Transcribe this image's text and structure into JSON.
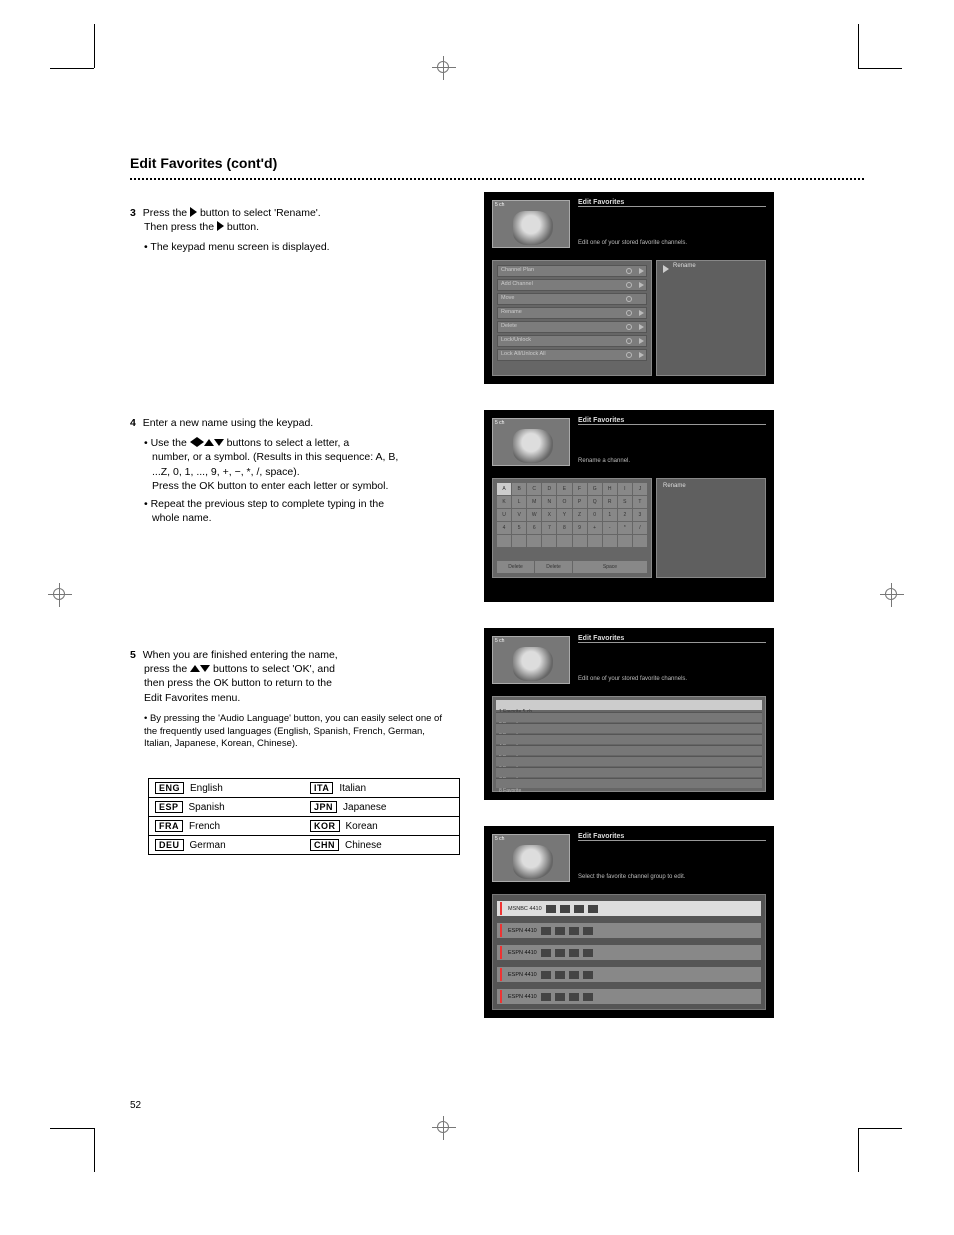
{
  "section_title": "Edit Favorites (cont'd)",
  "blocks": {
    "b1": {
      "num": "3",
      "line1_a": "Press the ",
      "line1_b": " button to select 'Rename'.",
      "line2_a": "Then press the ",
      "line2_b": " button.",
      "bullet": "The keypad menu screen is displayed."
    },
    "b2": {
      "num": "4",
      "line1": "Enter a new name using the keypad.",
      "arrows_a": "Use the ",
      "arrows_b": " buttons to select a letter, a",
      "l2": "number, or a symbol. (Results in this sequence: A, B,",
      "l3": "...Z, 0, 1, ..., 9, +, −, *, /, space).",
      "l4": "Press the OK button to enter each letter or symbol.",
      "l5": "Repeat the previous step to complete typing in the",
      "l6": "whole name."
    },
    "b3": {
      "num": "5",
      "line1": "When you are finished entering the name,",
      "arrows_a": "press the ",
      "arrows_b": " buttons to select 'OK', and",
      "l3": "then press the OK button to return to the",
      "l4": "Edit Favorites menu.",
      "sub": "By pressing the 'Audio Language' button, you can easily select one of the frequently used languages (English, Spanish, French, German, Italian, Japanese, Korean, Chinese)."
    }
  },
  "lang_table": [
    [
      {
        "chip": "ENG",
        "name": "English"
      },
      {
        "chip": "ITA",
        "name": "Italian"
      }
    ],
    [
      {
        "chip": "ESP",
        "name": "Spanish"
      },
      {
        "chip": "JPN",
        "name": "Japanese"
      }
    ],
    [
      {
        "chip": "FRA",
        "name": "French"
      },
      {
        "chip": "KOR",
        "name": "Korean"
      }
    ],
    [
      {
        "chip": "DEU",
        "name": "German"
      },
      {
        "chip": "CHN",
        "name": "Chinese"
      }
    ]
  ],
  "panel1": {
    "title": "Edit Favorites",
    "subtitle": "Edit one of your stored favorite channels.",
    "rows": [
      "Channel Plan",
      "Add Channel",
      "Move",
      "Rename",
      "Delete",
      "Lock/Unlock",
      "Lock All/Unlock All"
    ],
    "right_label": "Rename"
  },
  "panel2": {
    "title": "Edit Favorites",
    "subtitle": "Rename a channel.",
    "right_label": "Rename",
    "bottom": [
      "Delete",
      "Delete",
      "Space"
    ]
  },
  "panel3": {
    "title": "Edit Favorites",
    "subtitle": "Edit one of your stored favorite channels.",
    "head": "1   Favorite                                                                     5 ch",
    "rows": [
      "2   Favorite",
      "3   Favorite",
      "4   Favorite",
      "5   Favorite",
      "6   Favorite",
      "7   Favorite",
      "8   Favorite"
    ]
  },
  "panel4": {
    "title": "Edit Favorites",
    "subtitle": "Select the favorite channel group to edit.",
    "rows": [
      {
        "label": "MSNBC  4410",
        "sel": true
      },
      {
        "label": "ESPN   4410",
        "sel": false
      },
      {
        "label": "ESPN   4410",
        "sel": false
      },
      {
        "label": "ESPN   4410",
        "sel": false
      },
      {
        "label": "ESPN   4410",
        "sel": false
      }
    ]
  },
  "footer": {
    "page": "52",
    "left": " ",
    "right": " "
  }
}
